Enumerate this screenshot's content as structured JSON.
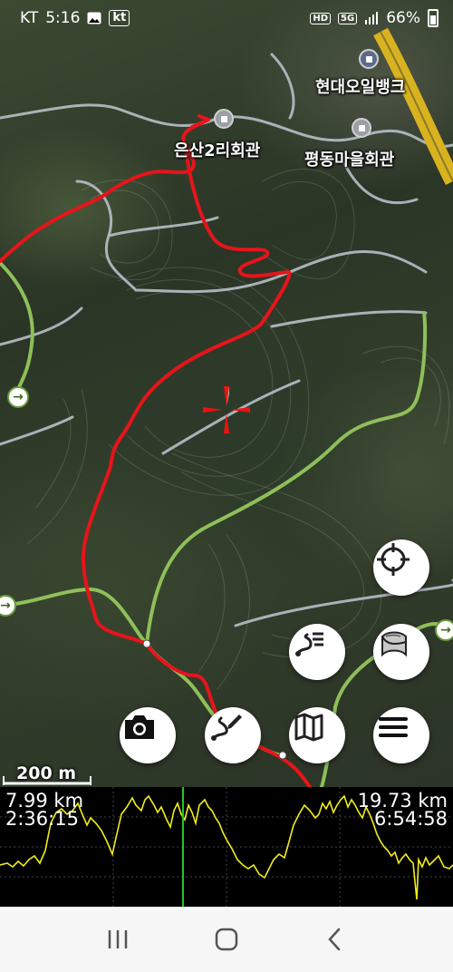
{
  "status_bar": {
    "carrier": "KT",
    "time": "5:16",
    "kt_badge": "kt",
    "hd_badge": "HD",
    "network": "5G",
    "battery": "66%",
    "icons": [
      "image-icon",
      "signal-icon",
      "battery-icon"
    ]
  },
  "map": {
    "labels": {
      "gas_station": "현대오일뱅크",
      "village_hall_1": "은산2리회관",
      "village_hall_2": "평동마을회관"
    },
    "scale": "200 m",
    "crosshair_icon": "crosshair-icon",
    "colors": {
      "track": "#e8141b",
      "trail": "#8fbf5a",
      "road": "#b7bfc7",
      "highway": "#d9b21f"
    }
  },
  "buttons": {
    "locate": "crosshair-locate-icon",
    "layers": "map-layers-icon",
    "route_list": "route-list-icon",
    "camera": "camera-icon",
    "draw_route": "draw-route-icon",
    "map": "map-icon",
    "menu": "menu-icon"
  },
  "elevation": {
    "left_distance": "7.99 km",
    "left_time": "2:36:15",
    "right_distance": "19.73 km",
    "right_time": "6:54:58",
    "cursor_fraction": 0.404,
    "colors": {
      "profile": "#f2ee19",
      "cursor": "#22c522",
      "grid": "#444444"
    }
  },
  "navbar": {
    "recent": "recent-apps-icon",
    "home": "home-icon",
    "back": "back-icon"
  }
}
